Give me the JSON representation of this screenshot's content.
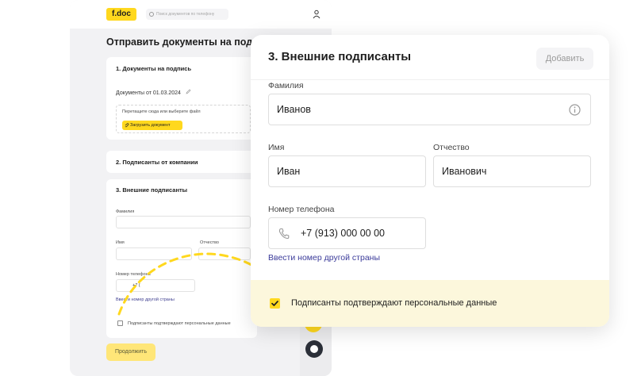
{
  "background_app": {
    "logo": "f.doc",
    "search_placeholder": "Поиск документов по телефону",
    "page_title": "Отправить документы на подпись",
    "section_documents": {
      "title": "1. Документы на подпись",
      "doc_line": "Документы от 01.03.2024",
      "drop_hint": "Перетащите сюда или выберите файл",
      "upload_button": "Загрузить документ"
    },
    "section_company_signers": {
      "title": "2. Подписанты от компании"
    },
    "section_external": {
      "title": "3. Внешние подписанты",
      "surname_label": "Фамилия",
      "name_label": "Имя",
      "patronymic_label": "Отчество",
      "phone_label": "Номер телефона",
      "phone_prefix": "+7 (",
      "other_country_link": "Ввести номер другой страны",
      "consent_text": "Подписанты подтверждают персональные данные"
    },
    "continue_button": "Продолжить"
  },
  "panel": {
    "title": "3. Внешние подписанты",
    "add_button": "Добавить",
    "surname": {
      "label": "Фамилия",
      "value": "Иванов"
    },
    "name": {
      "label": "Имя",
      "value": "Иван"
    },
    "patronymic": {
      "label": "Отчество",
      "value": "Иванович"
    },
    "phone": {
      "label": "Номер телефона",
      "value": "+7 (913) 000 00 00"
    },
    "other_country_link": "Ввести номер другой страны",
    "consent": {
      "text": "Подписанты подтверждают персональные данные",
      "checked": true
    }
  },
  "colors": {
    "accent_yellow": "#ffd81e",
    "confirm_band": "#fcf7dc",
    "link_blue": "#3b3b9a",
    "chat_button": "#2b2f38"
  },
  "icons": [
    "search-icon",
    "user-icon",
    "pencil-icon",
    "attachment-icon",
    "info-icon",
    "phone-icon",
    "checkmark-icon",
    "chat-icon",
    "dashed-arrow-icon"
  ]
}
